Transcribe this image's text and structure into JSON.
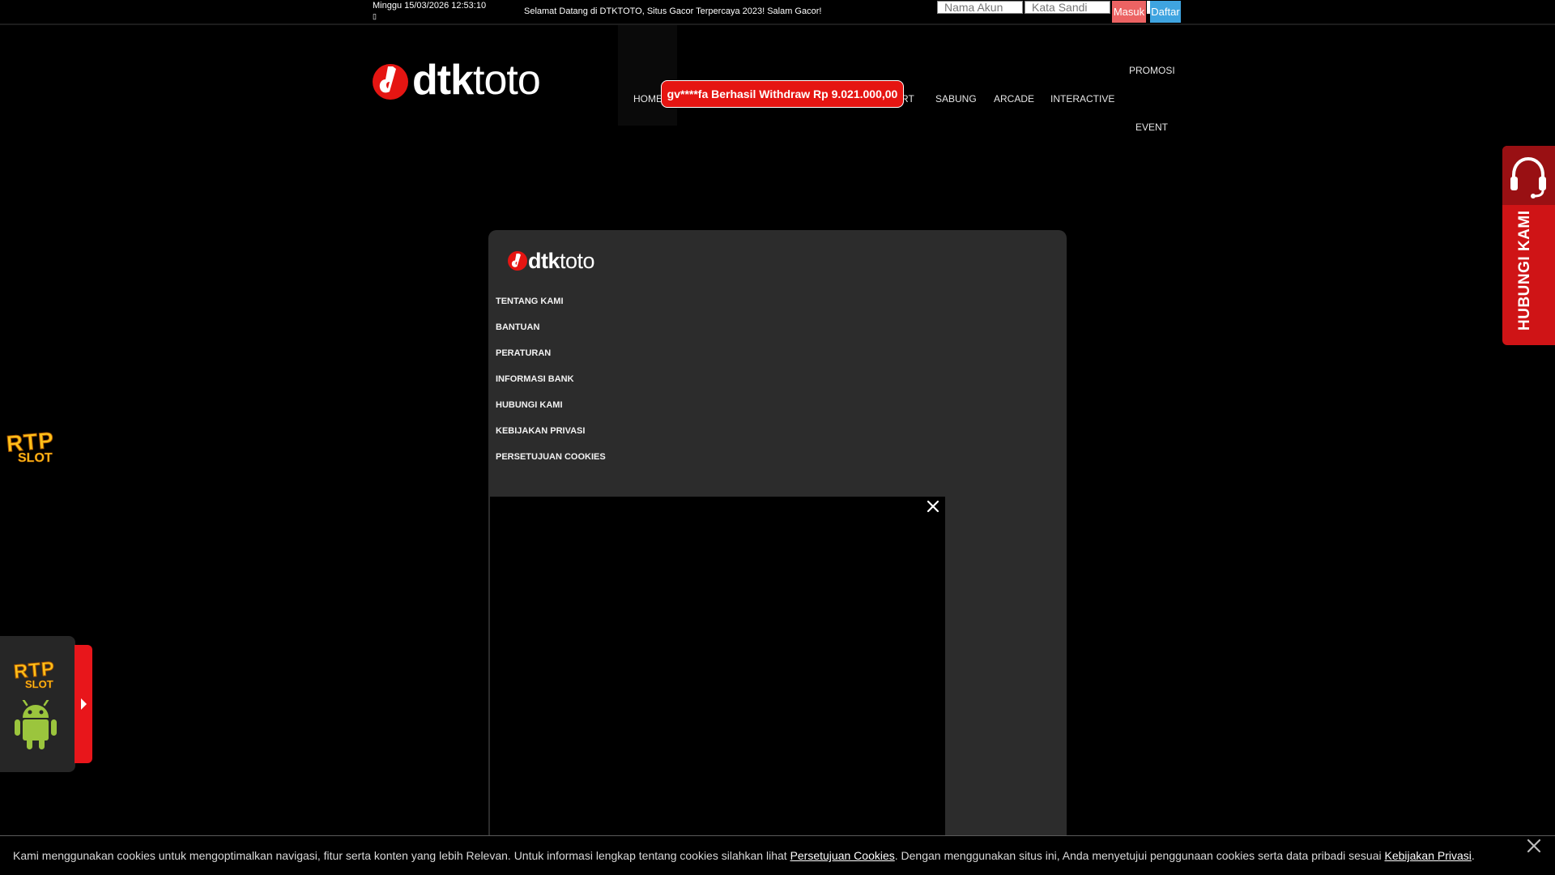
{
  "topbar": {
    "datetime": "Minggu 15/03/2026 12:53:10",
    "datetime_glyph": "▯",
    "welcome": "Selamat Datang di DTKTOTO, Situs Gacor Terpercaya 2023! Salam Gacor!",
    "username_placeholder": "Nama Akun",
    "password_placeholder": "Kata Sandi",
    "login_label": "Masuk",
    "register_label": "Daftar"
  },
  "brand": {
    "logo_prefix": "dtk",
    "logo_suffix": "toto",
    "logo_red": "#e51512"
  },
  "nav": {
    "home": "HOME",
    "sport": "RT",
    "sabung": "SABUNG",
    "arcade": "ARCADE",
    "interactive": "INTERACTIVE",
    "promosi": "PROMOSI",
    "event": "EVENT"
  },
  "ticker": {
    "withdraw_text": "gv****fa Berhasil Withdraw Rp 9.021.000,00"
  },
  "footer": {
    "links": [
      "TENTANG KAMI",
      "BANTUAN",
      "PERATURAN",
      "INFORMASI BANK",
      "HUBUNGI KAMI",
      "KEBIJAKAN PRIVASI",
      "PERSETUJUAN COOKIES"
    ]
  },
  "support": {
    "label": "HUBUNGI KAMI",
    "icon": "headset-icon"
  },
  "widgets": {
    "rtp_line1": "RTP",
    "rtp_line2": "SLOT",
    "android_icon": "android-icon"
  },
  "cookie": {
    "text_before": "Kami menggunakan cookies untuk mengoptimalkan navigasi, fitur serta konten yang lebih Relevan. Untuk informasi lengkap tentang cookies silahkan lihat ",
    "link_cookies": "Persetujuan Cookies",
    "text_middle": ". Dengan menggunakan situs ini, Anda menyetujui penggunaan cookies serta data pribadi sesuai ",
    "link_privacy": "Kebijakan Privasi",
    "text_after": "."
  }
}
